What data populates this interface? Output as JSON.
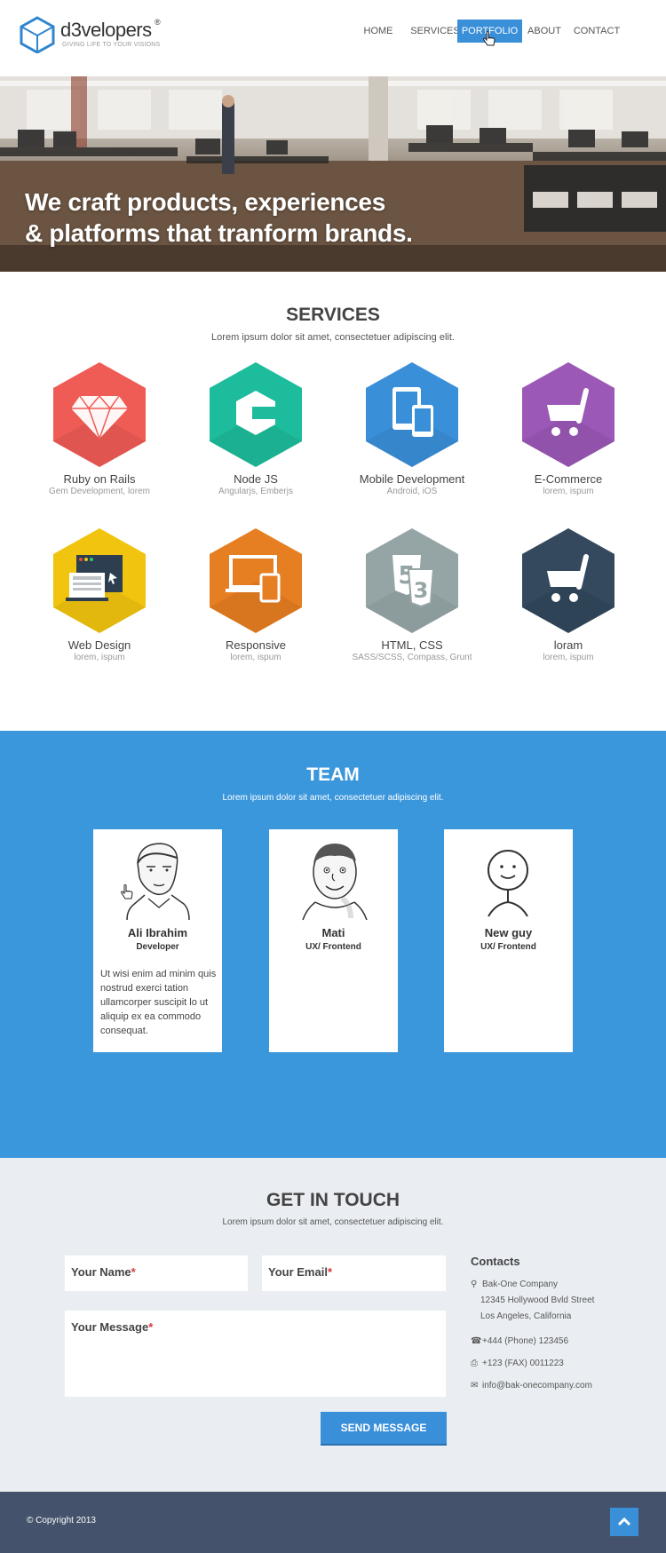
{
  "brand": {
    "name": "d3velopers",
    "reg": "®",
    "tagline": "GIVING LIFE TO YOUR VISIONS"
  },
  "nav": {
    "items": [
      "HOME",
      "SERVICES",
      "PORTFOLIO",
      "ABOUT",
      "CONTACT"
    ],
    "active": "PORTFOLIO"
  },
  "hero": {
    "line1": "We craft products, experiences",
    "line2": "& platforms that tranform brands."
  },
  "services": {
    "title": "SERVICES",
    "subtitle": "Lorem ipsum dolor sit amet, consectetuer adipiscing elit.",
    "items": [
      {
        "name": "Ruby on Rails",
        "desc": "Gem Development, lorem",
        "color": "#ef5b55",
        "icon": "diamond-icon"
      },
      {
        "name": "Node JS",
        "desc": "Angularjs,  Emberjs",
        "color": "#1dbc9c",
        "icon": "node-icon"
      },
      {
        "name": "Mobile Development",
        "desc": "Android, iOS",
        "color": "#3a8fd9",
        "icon": "devices-icon"
      },
      {
        "name": "E-Commerce",
        "desc": "lorem, ispum",
        "color": "#9b58b6",
        "icon": "cart-icon"
      },
      {
        "name": "Web Design",
        "desc": "lorem, ispum",
        "color": "#f1c40f",
        "icon": "browser-icon"
      },
      {
        "name": "Responsive",
        "desc": "lorem, ispum",
        "color": "#e67e22",
        "icon": "responsive-icon"
      },
      {
        "name": "HTML, CSS",
        "desc": "SASS/SCSS, Compass, Grunt",
        "color": "#95a5a6",
        "icon": "html5-icon"
      },
      {
        "name": "loram",
        "desc": "lorem, ispum",
        "color": "#34495e",
        "icon": "cart-icon"
      }
    ]
  },
  "team": {
    "title": "TEAM",
    "subtitle": "Lorem ipsum dolor sit amet, consectetuer adipiscing elit.",
    "members": [
      {
        "name": "Ali Ibrahim",
        "role": "Developer",
        "bio": "Ut wisi enim ad minim quis nostrud exerci tation ullamcorper suscipit lo ut aliquip ex ea commodo consequat."
      },
      {
        "name": "Mati",
        "role": "UX/ Frontend",
        "bio": ""
      },
      {
        "name": "New guy",
        "role": "UX/ Frontend",
        "bio": ""
      }
    ]
  },
  "contact": {
    "title": "GET IN TOUCH",
    "subtitle": "Lorem ipsum dolor sit amet, consectetuer adipiscing elit.",
    "name_label": "Your Name",
    "email_label": "Your Email",
    "message_label": "Your Message",
    "required_mark": "*",
    "send_label": "SEND MESSAGE",
    "contacts_title": "Contacts",
    "company": "Bak-One Company",
    "street": "12345 Hollywood Bvld Street",
    "city": "Los Angeles, California",
    "phone": "+444 (Phone) 123456",
    "fax": "+123 (FAX) 0011223",
    "email": "info@bak-onecompany.com"
  },
  "footer": {
    "copyright": "© Copyright 2013"
  }
}
